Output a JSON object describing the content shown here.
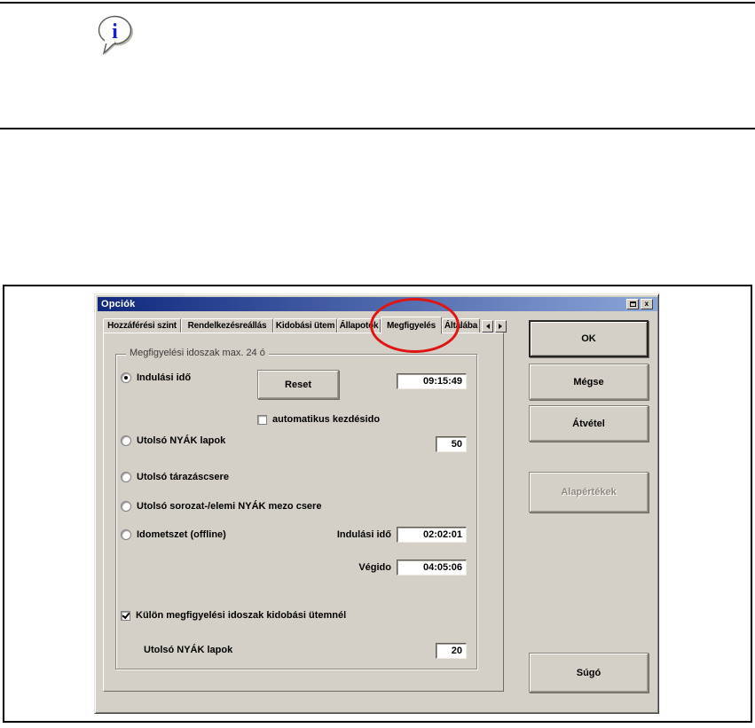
{
  "doc": {
    "info_icon_glyph": "i"
  },
  "colors": {
    "dialog_bg": "#d4d0c8",
    "titlebar_start": "#10287e",
    "titlebar_end": "#8ba6d8",
    "highlight_ellipse": "#df1414",
    "info_i": "#1a1ad2"
  },
  "dialog": {
    "title": "Opciók",
    "titlebar": {
      "close_glyph": "x"
    },
    "tabs": [
      {
        "label": "Hozzáférési szint"
      },
      {
        "label": "Rendelkezésreállás"
      },
      {
        "label": "Kidobási ütem"
      },
      {
        "label": "Állapotok"
      },
      {
        "label": "Megfigyelés"
      },
      {
        "label": "Általába"
      }
    ],
    "active_tab": "Megfigyelés",
    "group": {
      "title": "Megfigyelési idoszak max. 24 ó",
      "radio_start_time": "Indulási idő",
      "reset_button": "Reset",
      "start_time_value": "09:15:49",
      "checkbox_auto": "automatikus kezdésido",
      "radio_last_pcb": "Utolsó NYÁK lapok",
      "last_pcb_value": "50",
      "radio_magazine_change": "Utolsó tárazáscsere",
      "radio_series_change": "Utolsó sorozat-/elemi NYÁK mezo csere",
      "radio_time_slice": "Idometszet (offline)",
      "slice_start_label": "Indulási idő",
      "slice_start_value": "02:02:01",
      "slice_end_label": "Végido",
      "slice_end_value": "04:05:06",
      "checkbox_separate": "Külön megfigyelési idoszak kidobási ütemnél",
      "separate_pcb_label": "Utolsó NYÁK lapok",
      "separate_pcb_value": "20"
    },
    "buttons": {
      "ok": "OK",
      "cancel": "Mégse",
      "apply": "Átvétel",
      "defaults": "Alapértékek",
      "help": "Súgó"
    }
  }
}
